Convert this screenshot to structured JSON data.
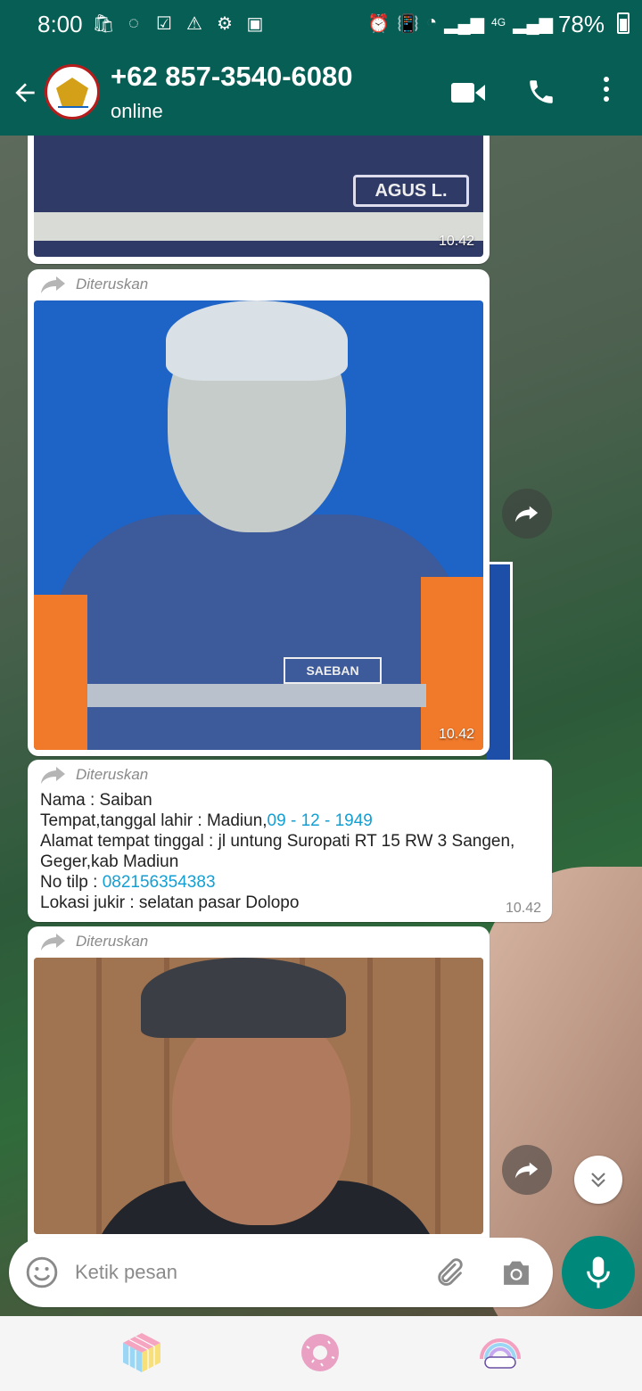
{
  "status_bar": {
    "time": "8:00",
    "battery": "78%",
    "network": "4G"
  },
  "header": {
    "contact_name": "+62 857-3540-6080",
    "status": "online"
  },
  "messages": [
    {
      "type": "image",
      "name_tag": "AGUS L.",
      "time": "10.42"
    },
    {
      "type": "image",
      "forwarded_label": "Diteruskan",
      "name_tag": "SAEBAN",
      "time": "10.42"
    },
    {
      "type": "text",
      "forwarded_label": "Diteruskan",
      "line1": "Nama : Saiban",
      "line2_prefix": "Tempat,tanggal lahir : Madiun,",
      "line2_link": "09 - 12 - 1949",
      "line3": "Alamat tempat tinggal : jl untung Suropati RT 15 RW 3 Sangen, Geger,kab Madiun",
      "line4_prefix": "No tilp : ",
      "line4_link": "082156354383",
      "line5": "Lokasi jukir : selatan pasar Dolopo",
      "time": "10.42"
    },
    {
      "type": "image",
      "forwarded_label": "Diteruskan"
    }
  ],
  "composer": {
    "placeholder": "Ketik pesan"
  },
  "colors": {
    "header": "#075e54",
    "accent": "#00897b",
    "link": "#139fd3"
  },
  "icons": [
    "back-arrow-icon",
    "video-call-icon",
    "phone-icon",
    "more-vert-icon",
    "forward-icon",
    "emoji-icon",
    "attach-icon",
    "camera-icon",
    "mic-icon",
    "chevron-double-down-icon"
  ]
}
